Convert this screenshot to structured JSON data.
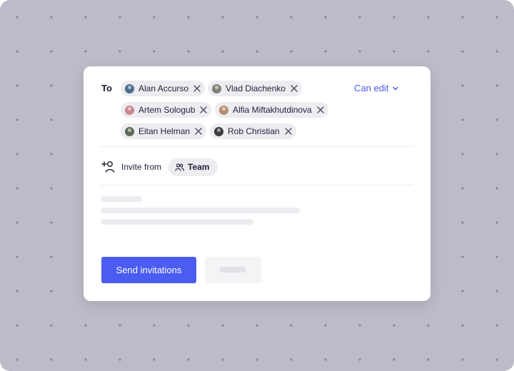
{
  "share": {
    "to_label": "To",
    "recipients": [
      {
        "name": "Alan Accurso",
        "avatar_color": "#4a6f8f"
      },
      {
        "name": "Vlad Diachenko",
        "avatar_color": "#7d8577"
      },
      {
        "name": "Artem Sologub",
        "avatar_color": "#c9878f"
      },
      {
        "name": "Alfia Miftakhutdinova",
        "avatar_color": "#b68e6e"
      },
      {
        "name": "Eitan Helman",
        "avatar_color": "#5e6a58"
      },
      {
        "name": "Rob Christian",
        "avatar_color": "#3b3a40"
      }
    ],
    "permission": "Can edit"
  },
  "invite": {
    "label": "Invite from",
    "source": "Team"
  },
  "actions": {
    "send_label": "Send invitations"
  },
  "colors": {
    "accent": "#4b5cf0",
    "link": "#4a5bdc",
    "chip_bg": "#ececf1",
    "backdrop": "#bcbcc9"
  }
}
